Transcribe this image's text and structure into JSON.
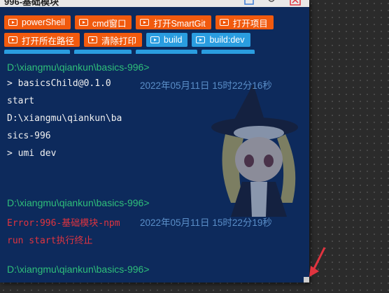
{
  "window": {
    "title": "996-基础模块",
    "accent": "#0d2a5c"
  },
  "quick_buttons": {
    "row1": [
      {
        "label": "powerShell",
        "color": "orange"
      },
      {
        "label": "cmd窗口",
        "color": "orange"
      },
      {
        "label": "打开SmartGit",
        "color": "orange"
      },
      {
        "label": "打开项目",
        "color": "orange"
      }
    ],
    "row2": [
      {
        "label": "打开所在路径",
        "color": "orange"
      },
      {
        "label": "清除打印",
        "color": "orange"
      },
      {
        "label": "build",
        "color": "blue"
      },
      {
        "label": "build:dev",
        "color": "blue"
      }
    ]
  },
  "terminal": {
    "path1": "D:\\xiangmu\\qiankun\\basics-996>",
    "cmd1": "> basicsChild@0.1.0",
    "ts1": "2022年05月11日 15时22分16秒",
    "out_start": "start",
    "out_path_a": "D:\\xiangmu\\qiankun\\ba",
    "out_path_b": "sics-996",
    "cmd2": "> umi dev",
    "path2": "D:\\xiangmu\\qiankun\\basics-996>",
    "error_a": "Error:996-基础模块-npm",
    "ts2": "2022年05月11日 15时22分19秒",
    "error_b": "run start执行终止",
    "path3": "D:\\xiangmu\\qiankun\\basics-996>"
  },
  "colors": {
    "orange": "#f15a0e",
    "blue": "#2a9de0",
    "path_green": "#2fbf7a",
    "error_red": "#e0343f"
  }
}
